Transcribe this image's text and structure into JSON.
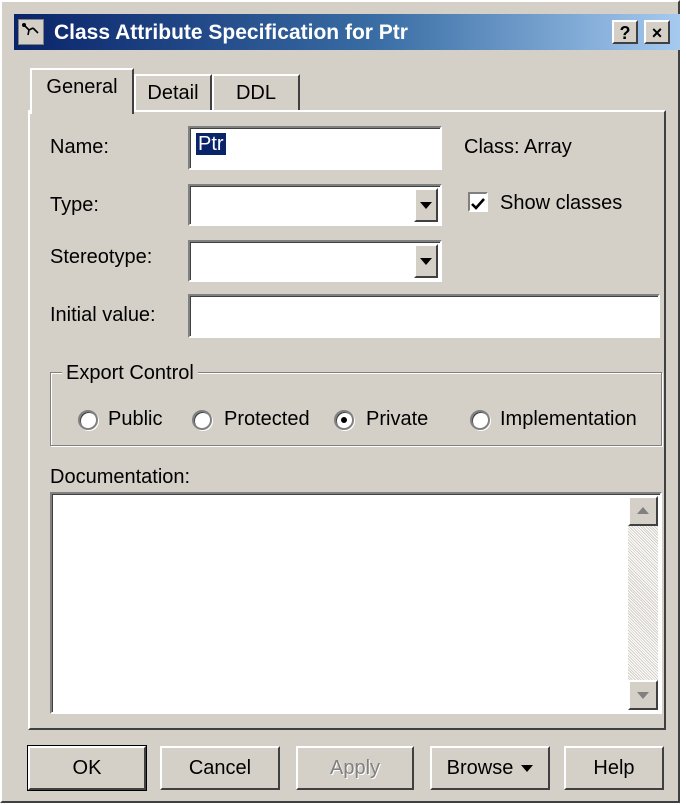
{
  "window": {
    "title": "Class Attribute Specification for Ptr",
    "help_btn": "?",
    "close_btn": "×"
  },
  "tabs": [
    {
      "label": "General",
      "active": true
    },
    {
      "label": "Detail",
      "active": false
    },
    {
      "label": "DDL",
      "active": false
    }
  ],
  "general": {
    "name_label": "Name:",
    "name_value": "Ptr",
    "class_info": "Class:  Array",
    "type_label": "Type:",
    "type_value": "",
    "show_classes_label": "Show classes",
    "show_classes_checked": true,
    "stereotype_label": "Stereotype:",
    "stereotype_value": "",
    "initial_value_label": "Initial value:",
    "initial_value": "",
    "export_control": {
      "legend": "Export Control",
      "options": [
        "Public",
        "Protected",
        "Private",
        "Implementation"
      ],
      "selected": "Private"
    },
    "documentation_label": "Documentation:",
    "documentation_value": ""
  },
  "buttons": {
    "ok": "OK",
    "cancel": "Cancel",
    "apply": "Apply",
    "browse": "Browse",
    "help": "Help"
  },
  "colors": {
    "title_gradient_start": "#0a246a",
    "title_gradient_end": "#a6caf0",
    "face": "#d4d0c8",
    "selection": "#0a246a"
  }
}
